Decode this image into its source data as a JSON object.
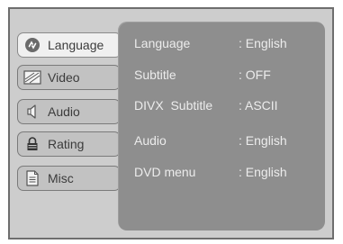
{
  "menu": {
    "tabs": [
      {
        "label": "Language",
        "icon": "language-icon",
        "active": true
      },
      {
        "label": "Video",
        "icon": "video-icon",
        "active": false
      },
      {
        "label": "Audio",
        "icon": "speaker-icon",
        "active": false
      },
      {
        "label": "Rating",
        "icon": "lock-icon",
        "active": false
      },
      {
        "label": "Misc",
        "icon": "document-icon",
        "active": false
      }
    ]
  },
  "settings": {
    "rows": [
      {
        "key": "Language",
        "value": ": English"
      },
      {
        "key": "Subtitle",
        "value": ": OFF"
      },
      {
        "key": "DIVX  Subtitle",
        "value": ": ASCII"
      },
      {
        "key": "Audio",
        "value": ": English"
      },
      {
        "key": "DVD menu",
        "value": ": English"
      }
    ]
  },
  "colors": {
    "frame_bg": "#cdcdcd",
    "panel_bg": "#8e8e8e",
    "active_tab_bg": "#f0f0f0",
    "inactive_tab_bg": "#c2c2c2",
    "panel_text": "#ececec"
  }
}
